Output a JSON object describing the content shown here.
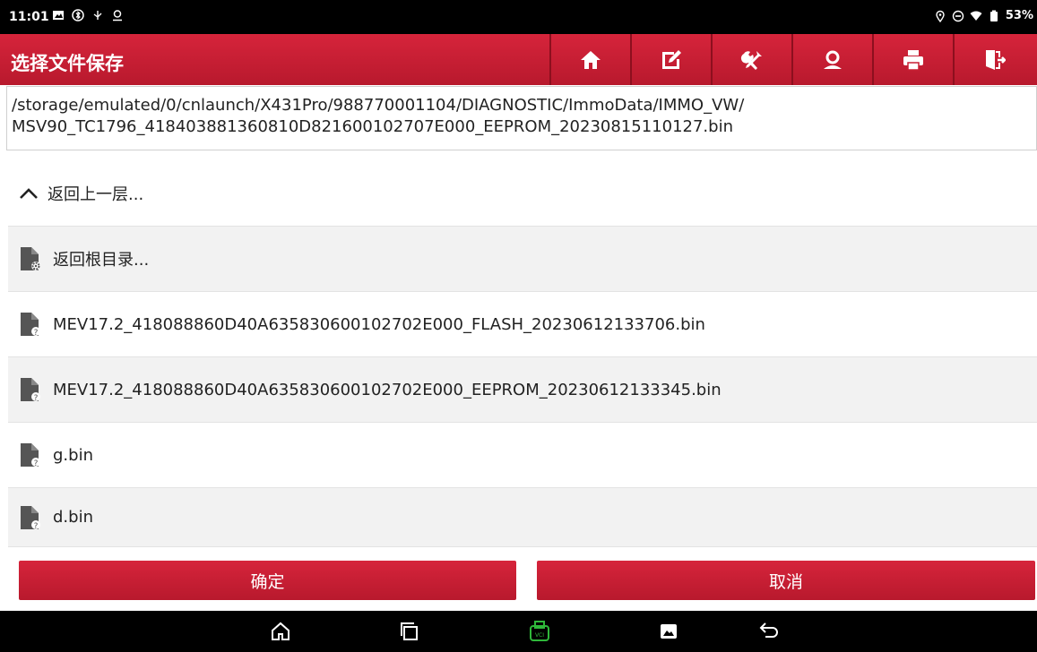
{
  "status": {
    "time": "11:01",
    "battery": "53%"
  },
  "header": {
    "title": "选择文件保存"
  },
  "toolbar": {
    "items": [
      "home-icon",
      "edit-note-icon",
      "tools-icon",
      "support-icon",
      "print-icon",
      "exit-icon"
    ]
  },
  "path": {
    "line1": "/storage/emulated/0/cnlaunch/X431Pro/988770001104/DIAGNOSTIC/ImmoData/IMMO_VW/",
    "line2": "MSV90_TC1796_418403881360810D821600102707E000_EEPROM_20230815110127.bin"
  },
  "list": {
    "up": "返回上一层...",
    "root": "返回根目录...",
    "files": [
      "MEV17.2_418088860D40A635830600102702E000_FLASH_20230612133706.bin",
      "MEV17.2_418088860D40A635830600102702E000_EEPROM_20230612133345.bin",
      "g.bin",
      "d.bin"
    ]
  },
  "buttons": {
    "ok": "确定",
    "cancel": "取消"
  },
  "colors": {
    "brand_red": "#c81e33",
    "vci_green": "#2fb83a"
  }
}
